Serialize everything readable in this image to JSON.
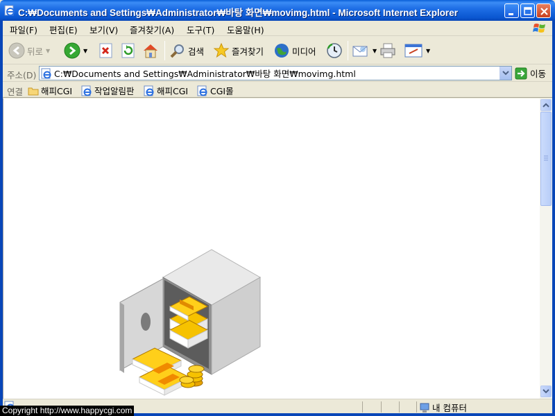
{
  "window": {
    "title": "C:₩Documents and Settings₩Administrator₩바탕 화면₩movimg.html - Microsoft Internet Explorer"
  },
  "menu": {
    "items": [
      {
        "label": "파일(F)"
      },
      {
        "label": "편집(E)"
      },
      {
        "label": "보기(V)"
      },
      {
        "label": "즐겨찾기(A)"
      },
      {
        "label": "도구(T)"
      },
      {
        "label": "도움말(H)"
      }
    ]
  },
  "toolbar": {
    "back_label": "뒤로",
    "search_label": "검색",
    "favorites_label": "즐겨찾기",
    "media_label": "미디어"
  },
  "address": {
    "label": "주소(D)",
    "value": "C:₩Documents and Settings₩Administrator₩바탕 화면₩movimg.html",
    "go_label": "이동"
  },
  "links": {
    "label": "연결",
    "items": [
      {
        "label": "해피CGI",
        "icon": "folder-icon"
      },
      {
        "label": "작업알림판",
        "icon": "ie-page-icon"
      },
      {
        "label": "해피CGI",
        "icon": "ie-page-icon"
      },
      {
        "label": "CGI몰",
        "icon": "ie-page-icon"
      }
    ]
  },
  "status": {
    "zone_label": "내 컴퓨터"
  },
  "content": {
    "image": "safe-with-money-icon"
  },
  "overlay": {
    "copyright": "Copyright  http://www.happycgi.com"
  },
  "colors": {
    "titlebar": "#0a56d0",
    "chrome": "#ece9d8",
    "close": "#c8401f",
    "gold": "#f5b400"
  }
}
